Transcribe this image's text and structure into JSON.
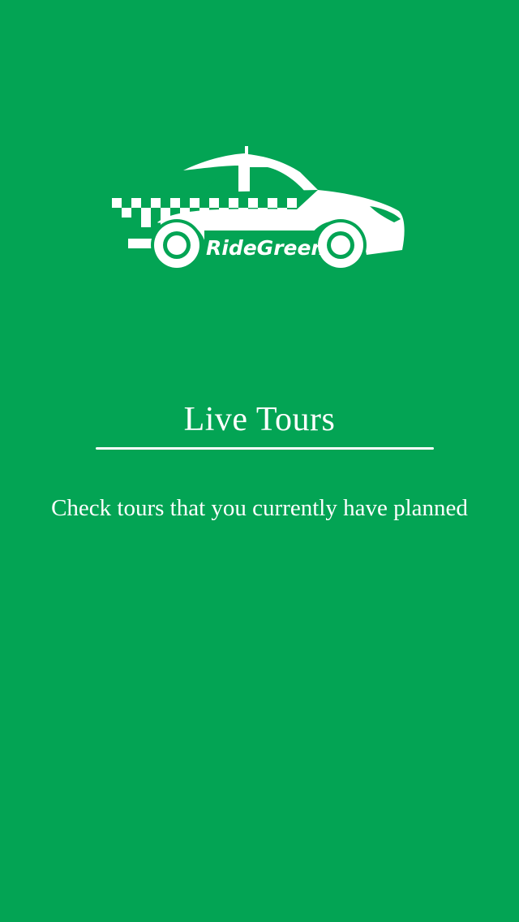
{
  "app": {
    "brand_name": "RideGreen",
    "logo_icon": "taxi-car-icon"
  },
  "onboarding": {
    "title": "Live Tours",
    "description": "Check tours that you currently have planned"
  },
  "colors": {
    "background": "#03a454",
    "foreground": "#ffffff"
  }
}
